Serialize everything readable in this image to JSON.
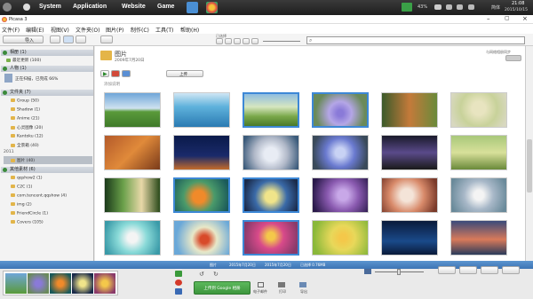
{
  "taskbar": {
    "menus": [
      "System",
      "Application",
      "Website",
      "Game"
    ],
    "battery": "43%",
    "volume_icon": "speaker-icon",
    "lang": "简体",
    "time": "21:08",
    "date": "2015/10/15"
  },
  "window": {
    "title": "Picasa 3"
  },
  "menubar": [
    "文件(F)",
    "编辑(E)",
    "视图(V)",
    "文件夹(O)",
    "图片(P)",
    "制作(C)",
    "工具(T)",
    "帮助(H)"
  ],
  "toolbar": {
    "import": "导入",
    "filter_label": "已选择"
  },
  "sidebar": {
    "groups": [
      {
        "label": "相册 (1)",
        "items": [
          "最近更新 (100)"
        ]
      },
      {
        "label": "人物 (1)",
        "items": [
          "正在扫描，已完成 66%"
        ]
      },
      {
        "label": "文件夹 (7)",
        "items": [
          "Group (50)",
          "Shadow (1)",
          "Anime (21)",
          "心灵图像 (20)",
          "Kantoku (12)",
          "全景箱 (40)"
        ]
      },
      {
        "label": "2011",
        "items": [
          "图片 (40)"
        ]
      },
      {
        "label": "其他素材 (6)",
        "items": [
          "qqshow2 (1)",
          "C2C (1)",
          "com.tencent.qqshow (4)",
          "img (2)",
          "FriendCircle (1)",
          "Covers (105)"
        ]
      }
    ]
  },
  "content": {
    "folder_title": "图片",
    "folder_date": "2009年7月20日",
    "share_btn": "上传",
    "desc_link": "添加说明",
    "right_hint": "与网络相册同步"
  },
  "statusbar": {
    "center": "图片",
    "info1": "2015年7月20日",
    "info2": "2015年7月20日",
    "info3": "已选择 0.76MB"
  },
  "traybar": {
    "upload_btn": "上传到 Google 相册",
    "actions": [
      "电子邮件",
      "打印",
      "导出"
    ]
  }
}
